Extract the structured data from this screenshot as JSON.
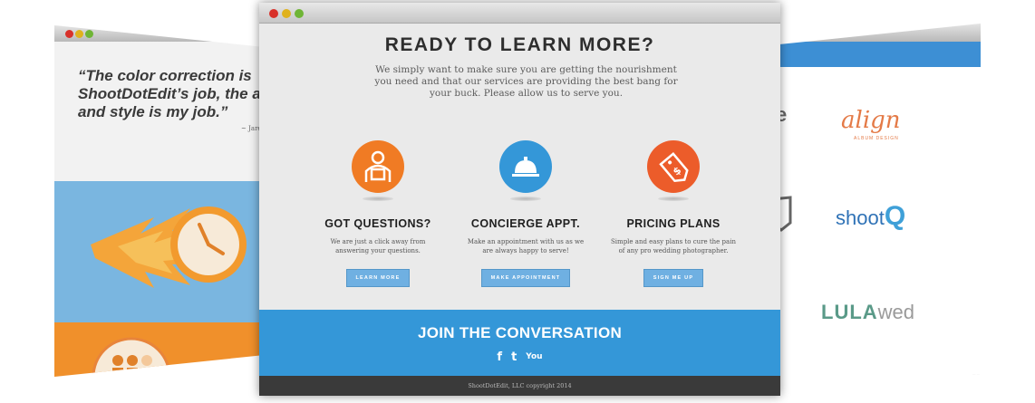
{
  "left_window": {
    "quote": "“The color correction is\nShootDotEdit’s job, the art\nand style is my job.”",
    "author": "~ Jare"
  },
  "right_window": {
    "logo_align": "align",
    "logo_align_sub": "ALBUM DESIGN",
    "logo_shoot": "shoot",
    "logo_shoot_q": "Q",
    "logo_lula": "LULA",
    "logo_wed": "wed",
    "edge_letter": "e"
  },
  "main": {
    "headline": "READY TO LEARN MORE?",
    "intro": "We simply want to make sure you are getting the nourishment you need and that our services are providing the best bang for your buck. Please allow us to serve you.",
    "features": [
      {
        "icon": "help-person-icon",
        "color": "#f07b24",
        "title": "GOT QUESTIONS?",
        "text": "We are just a click away from answering your questions.",
        "button": "LEARN MORE"
      },
      {
        "icon": "service-bell-icon",
        "color": "#3497d8",
        "title": "CONCIERGE APPT.",
        "text": "Make an appointment with us as we are always happy to serve!",
        "button": "MAKE APPOINTMENT"
      },
      {
        "icon": "price-tag-icon",
        "color": "#ec5c2a",
        "title": "PRICING PLANS",
        "text": "Simple and easy plans to cure the pain of any pro wedding photographer.",
        "button": "SIGN ME UP"
      }
    ],
    "join_title": "JOIN THE CONVERSATION",
    "social": [
      "facebook-icon",
      "twitter-icon",
      "youtube-icon"
    ],
    "social_glyphs": [
      "f",
      "t",
      "You"
    ],
    "footer": "ShootDotEdit, LLC copyright 2014"
  },
  "colors": {
    "accent_blue": "#3497d8",
    "button_blue": "#6fb0e2",
    "footer_dark": "#3a3a3a"
  }
}
